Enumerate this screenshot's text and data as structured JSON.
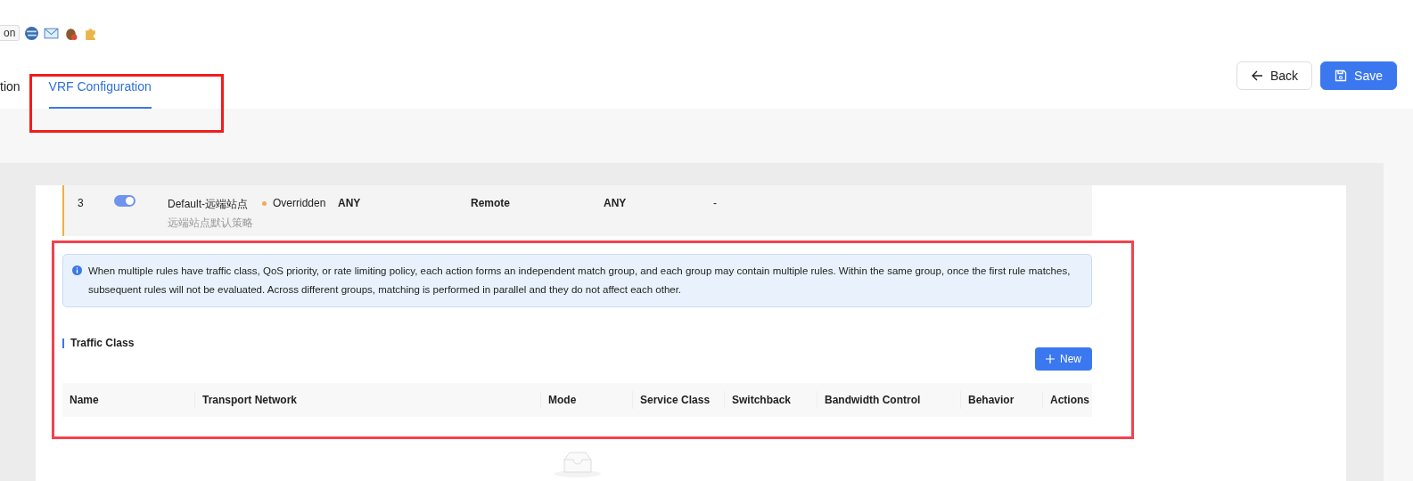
{
  "toolbar": {
    "button": "on"
  },
  "tabs": [
    {
      "label": "tion",
      "selected": false
    },
    {
      "label": "VRF Configuration",
      "selected": true
    }
  ],
  "actions": [
    {
      "label": "Back",
      "kind": "back"
    },
    {
      "label": "Save",
      "kind": "save"
    }
  ],
  "rule_row": {
    "index": "3",
    "enabled": true,
    "name": "Default-远端站点",
    "description": "远端站点默认策略",
    "status": {
      "label": "Overridden",
      "color": "#f0ad4e"
    },
    "column_4": "ANY",
    "column_5": "Remote",
    "column_6": "ANY",
    "column_7": "-"
  },
  "alert": "When multiple rules have traffic class, QoS priority, or rate limiting policy, each action forms an independent match group, and each group may contain multiple rules. Within the same group, once the first rule matches, subsequent rules will not be evaluated. Across different groups, matching is performed in parallel and they do not affect each other.",
  "traffic_class": {
    "title": "Traffic Class",
    "new_button": "New",
    "columns": [
      "Name",
      "Transport Network",
      "Mode",
      "Service Class",
      "Switchback",
      "Bandwidth Control",
      "Behavior",
      "Actions"
    ]
  }
}
